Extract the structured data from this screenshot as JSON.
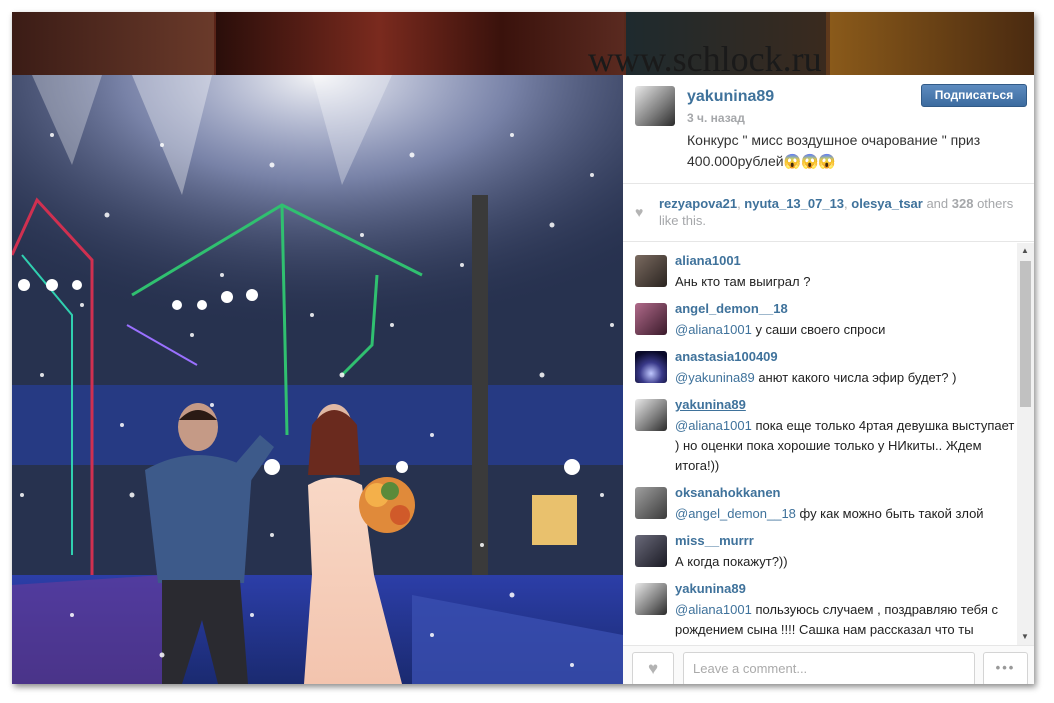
{
  "watermark": "www.schlock.ru",
  "post": {
    "username": "yakunina89",
    "time": "3 ч. назад",
    "caption": "Конкурс \" мисс воздушное очарование \" приз 400.000рублей😱😱😱",
    "follow_label": "Подписаться"
  },
  "likes": {
    "user1": "rezyapova21",
    "sep1": ", ",
    "user2": "nyuta_13_07_13",
    "sep2": ", ",
    "user3": "olesya_tsar",
    "and": " and ",
    "count": "328",
    "others": " others like this."
  },
  "comments": [
    {
      "user": "aliana1001",
      "mention": "",
      "text": "Ань кто там выиграл ?"
    },
    {
      "user": "angel_demon__18",
      "mention": "@aliana1001",
      "text": " у саши своего спроси"
    },
    {
      "user": "anastasia100409",
      "mention": "@yakunina89",
      "text": " анют какого числа эфир будет? )"
    },
    {
      "user": "yakunina89",
      "mention": "@aliana1001",
      "text": " пока еще только 4ртая девушка выступает ) но оценки пока хорошие только у НИкиты.. Ждем итога!))"
    },
    {
      "user": "oksanahokkanen",
      "mention": "@angel_demon__18",
      "text": " фу как можно быть такой злой"
    },
    {
      "user": "miss__murrr",
      "mention": "",
      "text": "А когда покажут?))"
    },
    {
      "user": "yakunina89",
      "mention": "@aliana1001",
      "text": " пользуюсь случаем , поздравляю тебя с рождением сына !!!! Сашка нам рассказал что ты"
    }
  ],
  "comment_placeholder": "Leave a comment...",
  "more_label": "•••",
  "icons": {
    "heart": "heart-icon",
    "more": "more-icon"
  }
}
